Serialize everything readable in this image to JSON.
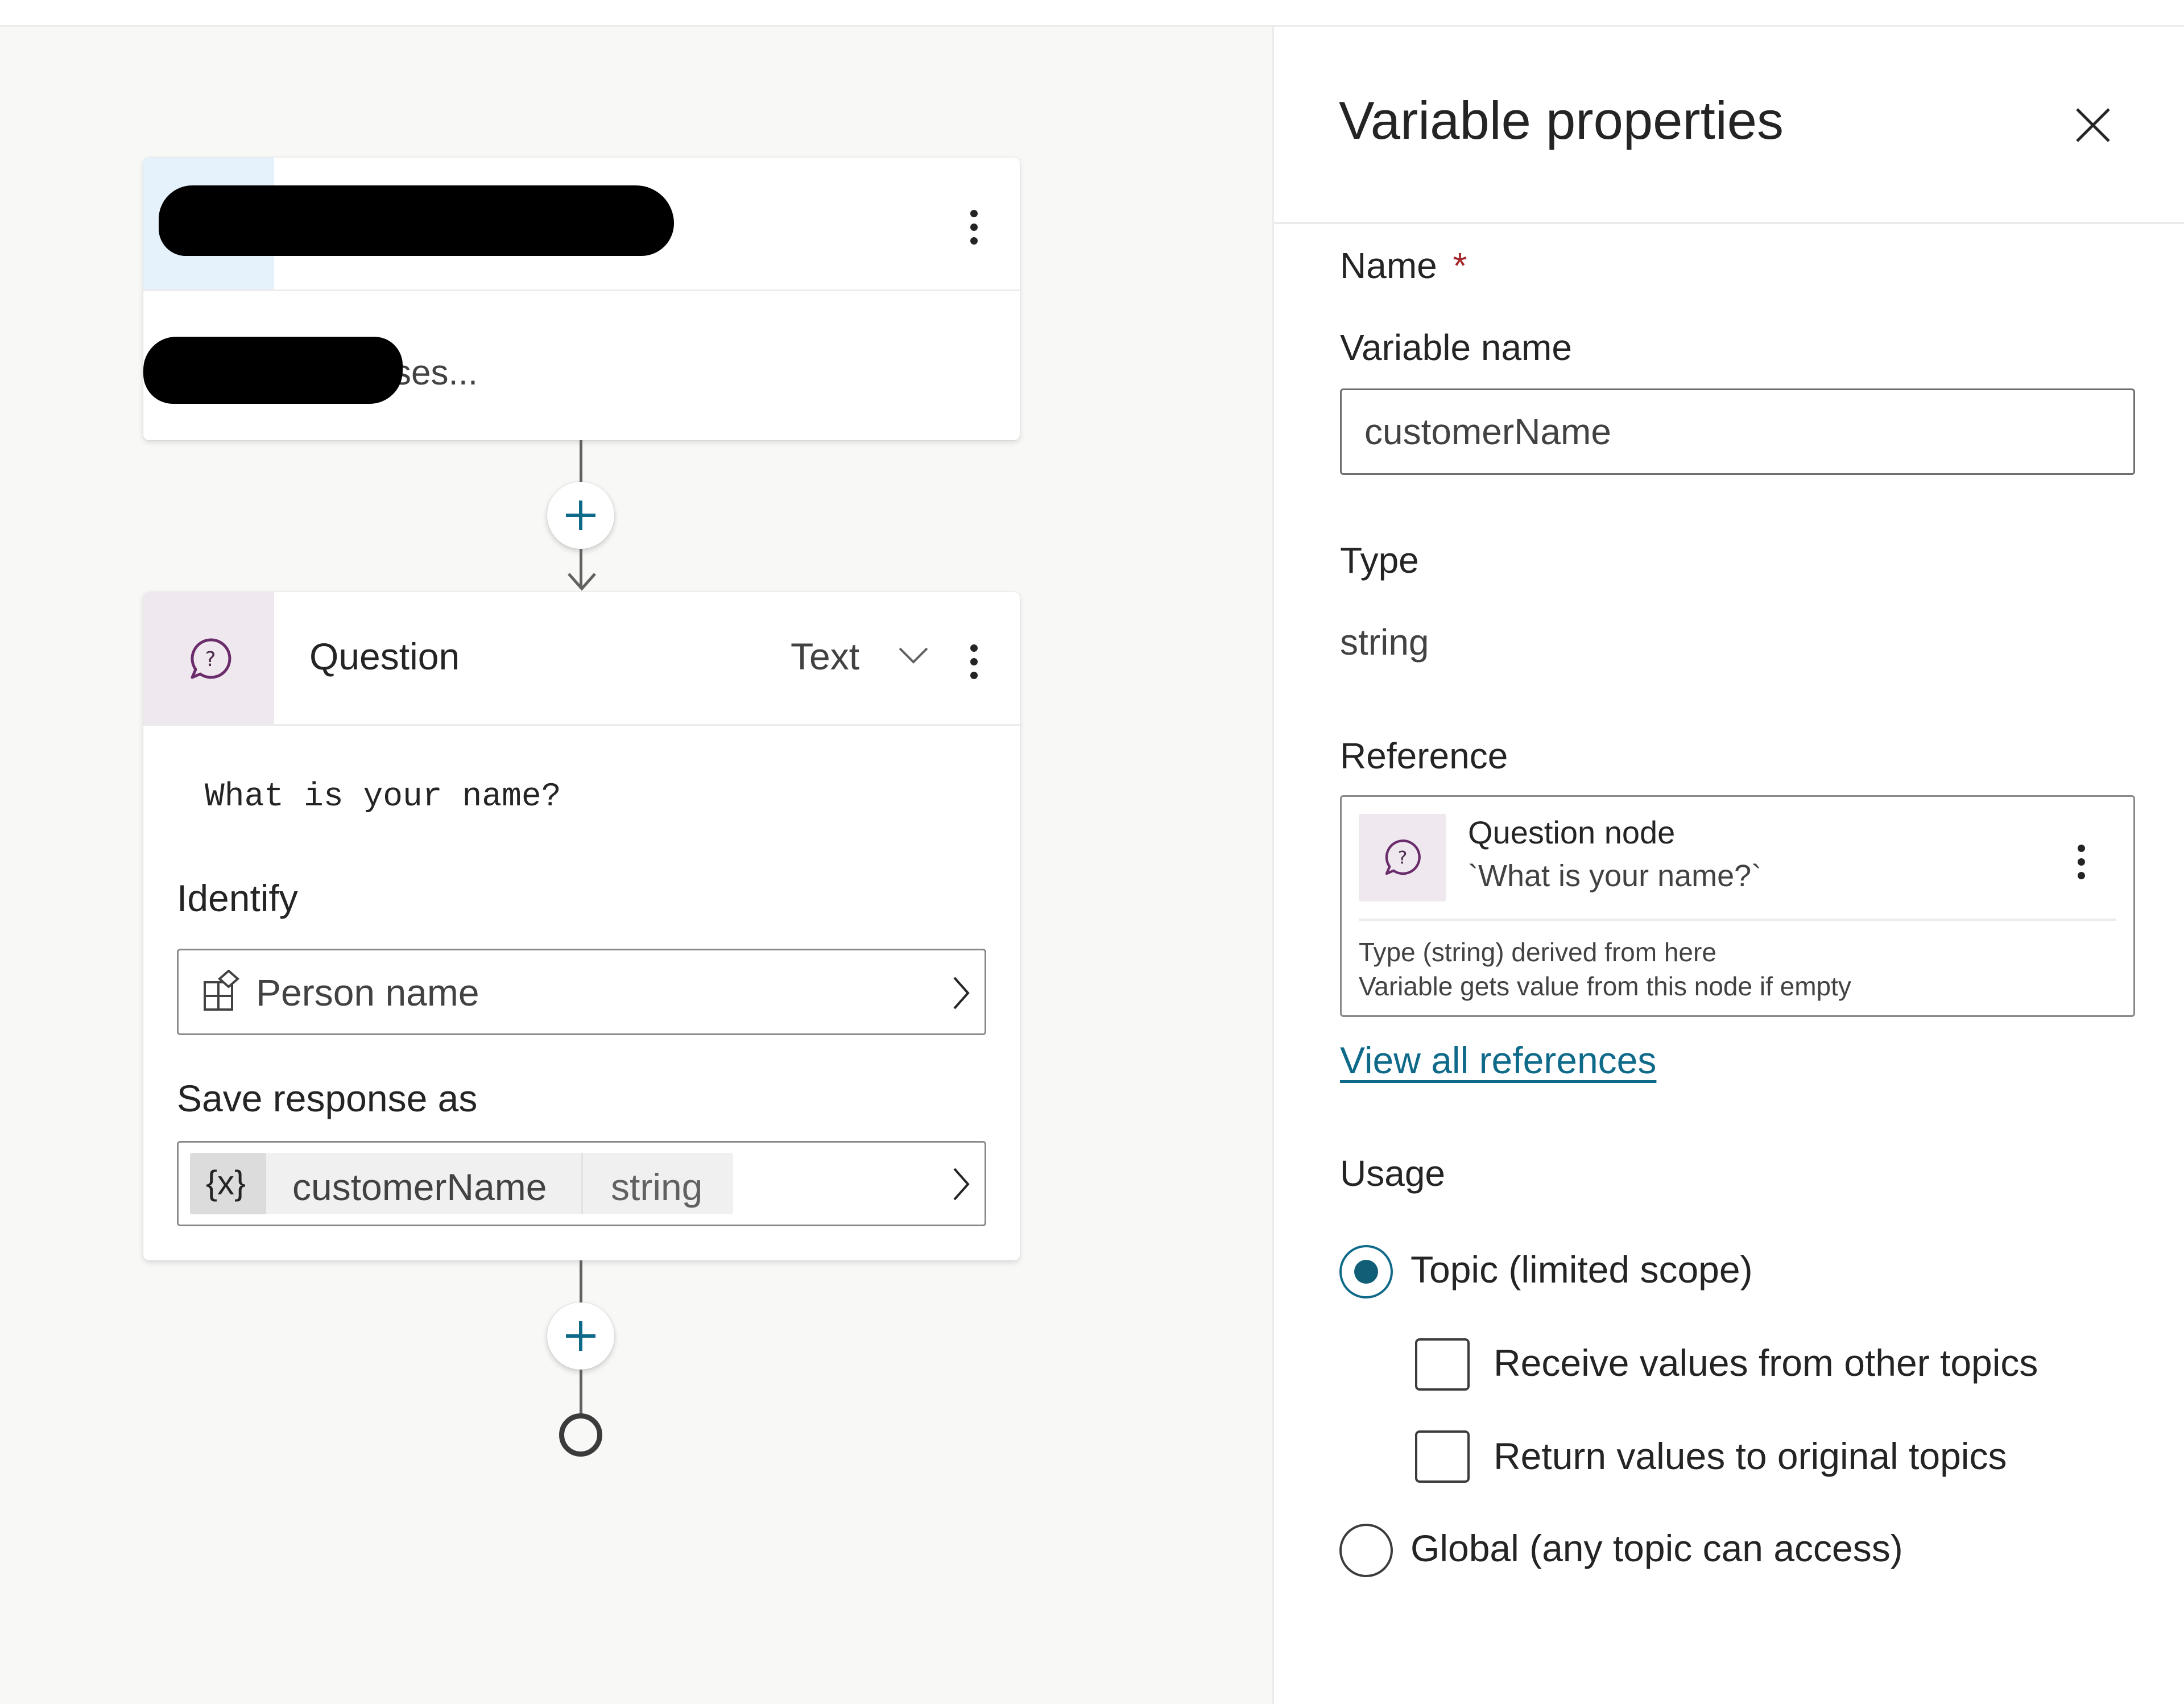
{
  "canvas": {
    "trigger_node": {
      "subtitle_visible_fragment": "ses..."
    },
    "question_node": {
      "title": "Question",
      "type_dropdown": "Text",
      "prompt": "What is your name?",
      "identify_label": "Identify",
      "identify_value": "Person name",
      "save_label": "Save response as",
      "variable_icon": "{x}",
      "variable_name": "customerName",
      "variable_type": "string"
    }
  },
  "panel": {
    "title": "Variable properties",
    "name_section": "Name",
    "required_marker": "*",
    "variable_name_label": "Variable name",
    "variable_name_value": "customerName",
    "type_label": "Type",
    "type_value": "string",
    "reference_label": "Reference",
    "reference": {
      "node_title": "Question node",
      "node_subtitle": "`What is your name?`",
      "note_line1": "Type (string) derived from here",
      "note_line2": "Variable gets value from this node if empty"
    },
    "view_all_link": "View all references",
    "usage_label": "Usage",
    "usage_options": [
      {
        "label": "Topic (limited scope)",
        "selected": true
      },
      {
        "label": "Global (any topic can access)",
        "selected": false
      }
    ],
    "topic_checkboxes": [
      {
        "label": "Receive values from other topics",
        "checked": false
      },
      {
        "label": "Return values to original topics",
        "checked": false
      }
    ]
  },
  "colors": {
    "accent": "#0f6a8a",
    "question_icon": "#6b2c6b",
    "question_icon_bg": "#efe9ef",
    "trigger_icon_bg": "#e5f2fc",
    "required": "#a4262c"
  }
}
